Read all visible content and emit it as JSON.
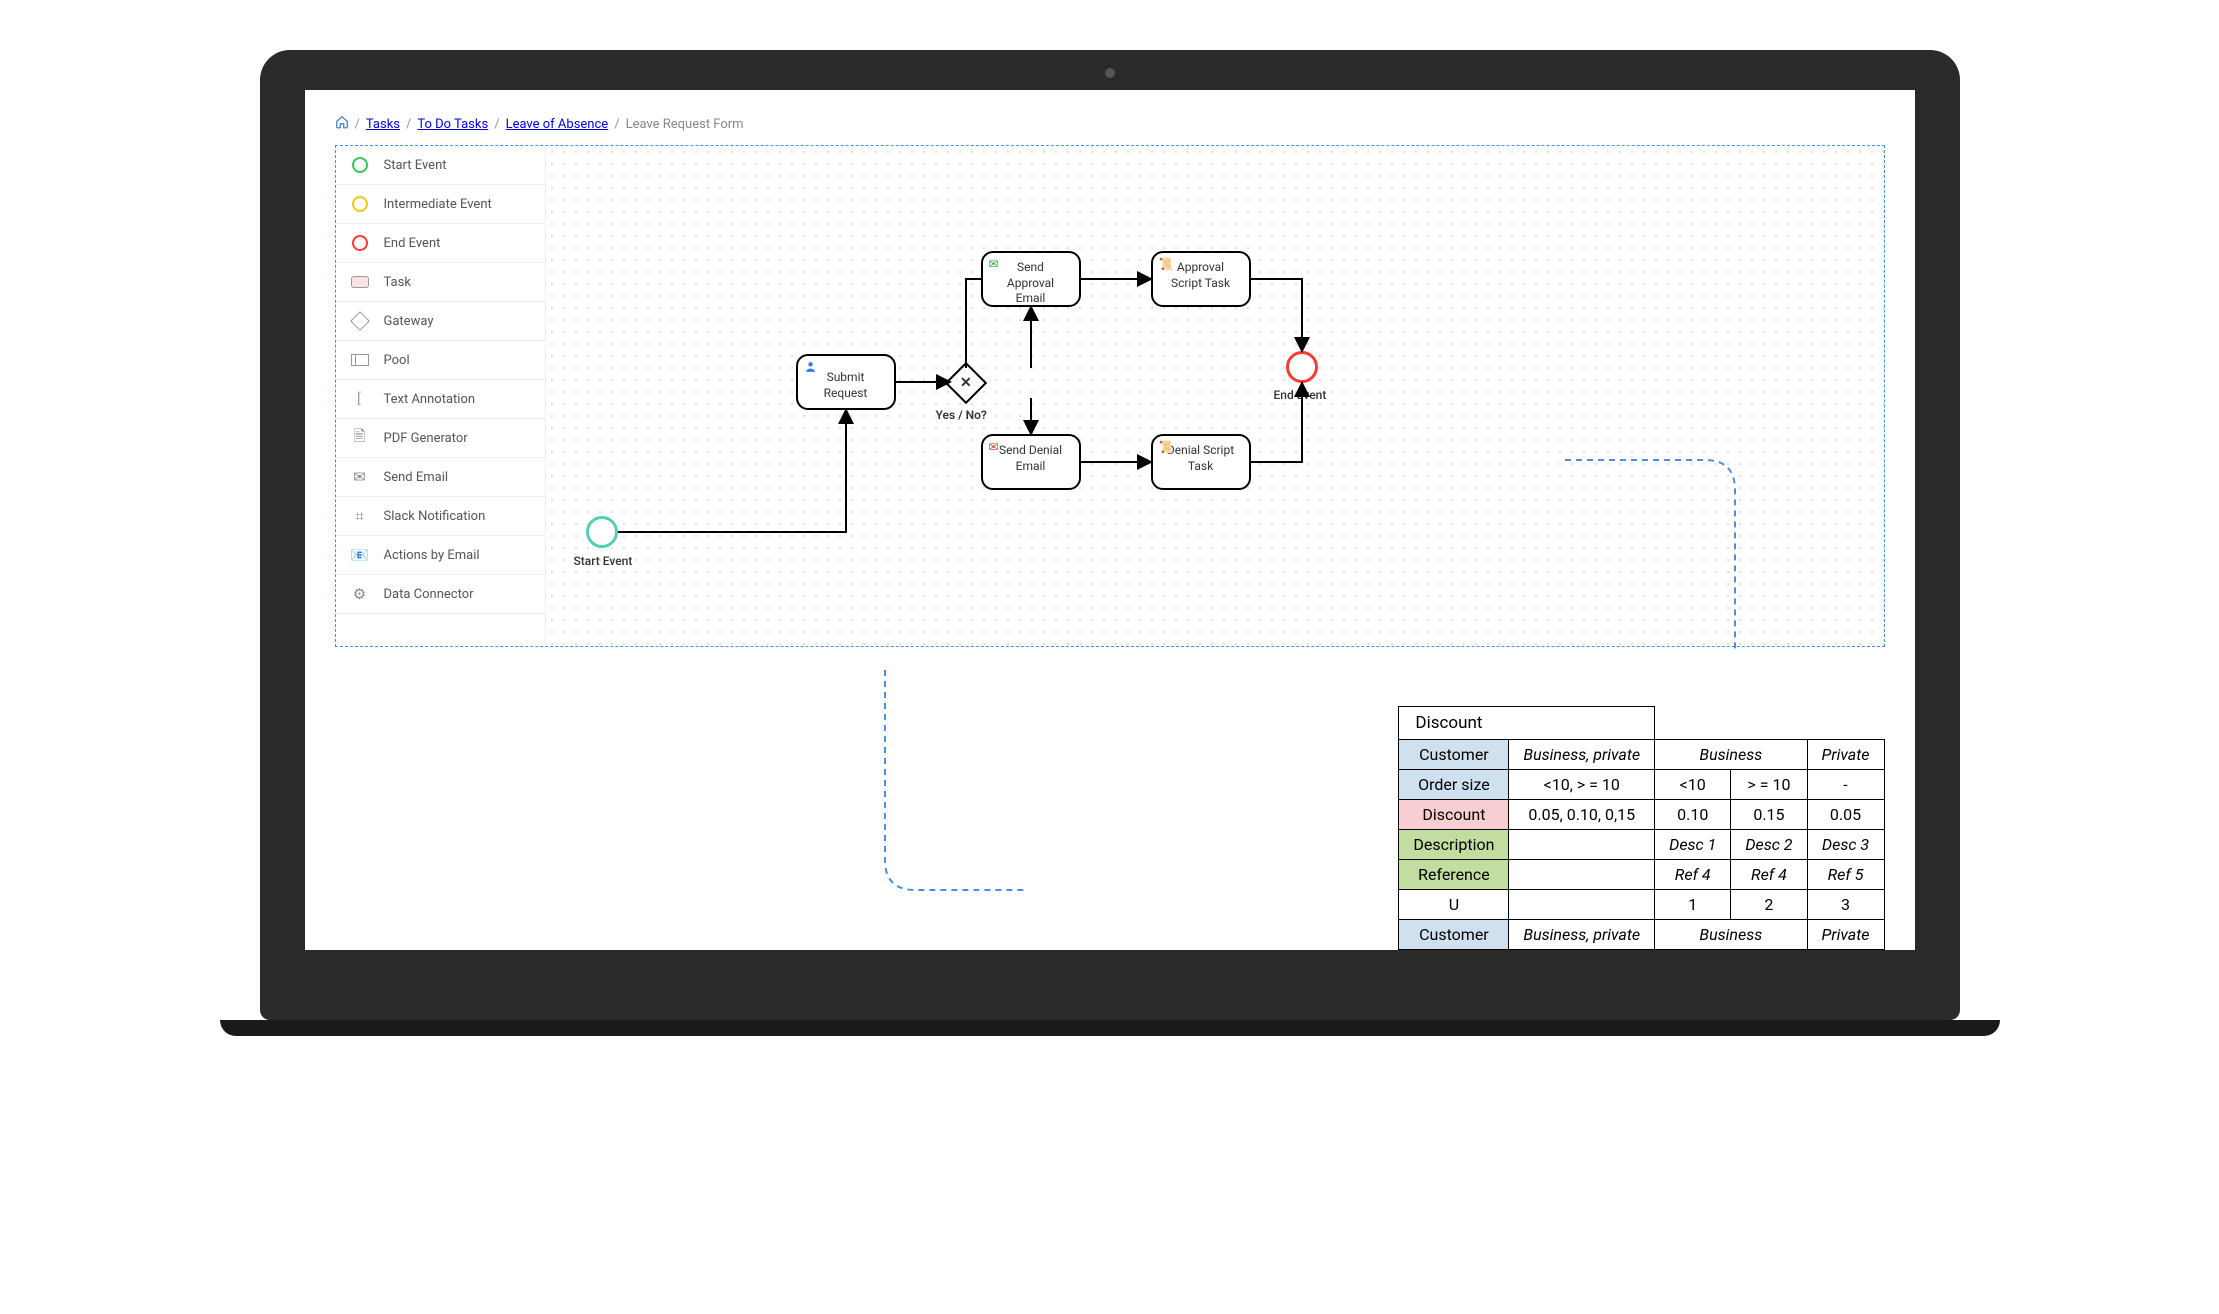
{
  "breadcrumbs": {
    "items": [
      "Tasks",
      "To Do Tasks",
      "Leave of Absence"
    ],
    "current": "Leave Request Form"
  },
  "palette": [
    {
      "id": "start-event",
      "label": "Start Event",
      "icon": "circ-green"
    },
    {
      "id": "intermediate-event",
      "label": "Intermediate Event",
      "icon": "circ-yellow"
    },
    {
      "id": "end-event",
      "label": "End Event",
      "icon": "circ-red"
    },
    {
      "id": "task",
      "label": "Task",
      "icon": "task-rect"
    },
    {
      "id": "gateway",
      "label": "Gateway",
      "icon": "gw"
    },
    {
      "id": "pool",
      "label": "Pool",
      "icon": "pool"
    },
    {
      "id": "text-annotation",
      "label": "Text Annotation",
      "icon": "["
    },
    {
      "id": "pdf-generator",
      "label": "PDF Generator",
      "icon": "pdf"
    },
    {
      "id": "send-email",
      "label": "Send Email",
      "icon": "mail"
    },
    {
      "id": "slack-notification",
      "label": "Slack Notification",
      "icon": "slack"
    },
    {
      "id": "actions-by-email",
      "label": "Actions by Email",
      "icon": "act"
    },
    {
      "id": "data-connector",
      "label": "Data Connector",
      "icon": "gear"
    }
  ],
  "diagram": {
    "start_label": "Start Event",
    "end_label": "End Event",
    "gateway_label": "Yes / No?",
    "nodes": {
      "submit": {
        "label": "Submit Request",
        "icon_color": "#2b7de9"
      },
      "send_approval": {
        "label": "Send Approval Email",
        "icon_color": "#23a838"
      },
      "send_denial": {
        "label": "Send Denial Email",
        "icon_color": "#d33a2c"
      },
      "approval_script": {
        "label": "Approval Script Task"
      },
      "denial_script": {
        "label": "Denial Script Task"
      }
    }
  },
  "discount_table": {
    "title": "Discount",
    "rows": [
      {
        "label": "Customer",
        "class": "blue",
        "cells": [
          "Business, private",
          "Business",
          "",
          "Private"
        ],
        "span": [
          1,
          2,
          0,
          1
        ],
        "ital": true
      },
      {
        "label": "Order size",
        "class": "blue",
        "cells": [
          "<10, > = 10",
          "<10",
          "> = 10",
          "-"
        ]
      },
      {
        "label": "Discount",
        "class": "pink",
        "cells": [
          "0.05, 0.10, 0,15",
          "0.10",
          "0.15",
          "0.05"
        ]
      },
      {
        "label": "Description",
        "class": "green",
        "cells": [
          "",
          "Desc 1",
          "Desc 2",
          "Desc 3"
        ],
        "ital": true
      },
      {
        "label": "Reference",
        "class": "green",
        "cells": [
          "",
          "Ref 4",
          "Ref 4",
          "Ref 5"
        ],
        "ital": true
      },
      {
        "label": "U",
        "class": "",
        "cells": [
          "",
          "1",
          "2",
          "3"
        ]
      },
      {
        "label": "Customer",
        "class": "blue",
        "cells": [
          "Business, private",
          "Business",
          "",
          "Private"
        ],
        "span": [
          1,
          2,
          0,
          1
        ],
        "ital": true
      }
    ]
  }
}
